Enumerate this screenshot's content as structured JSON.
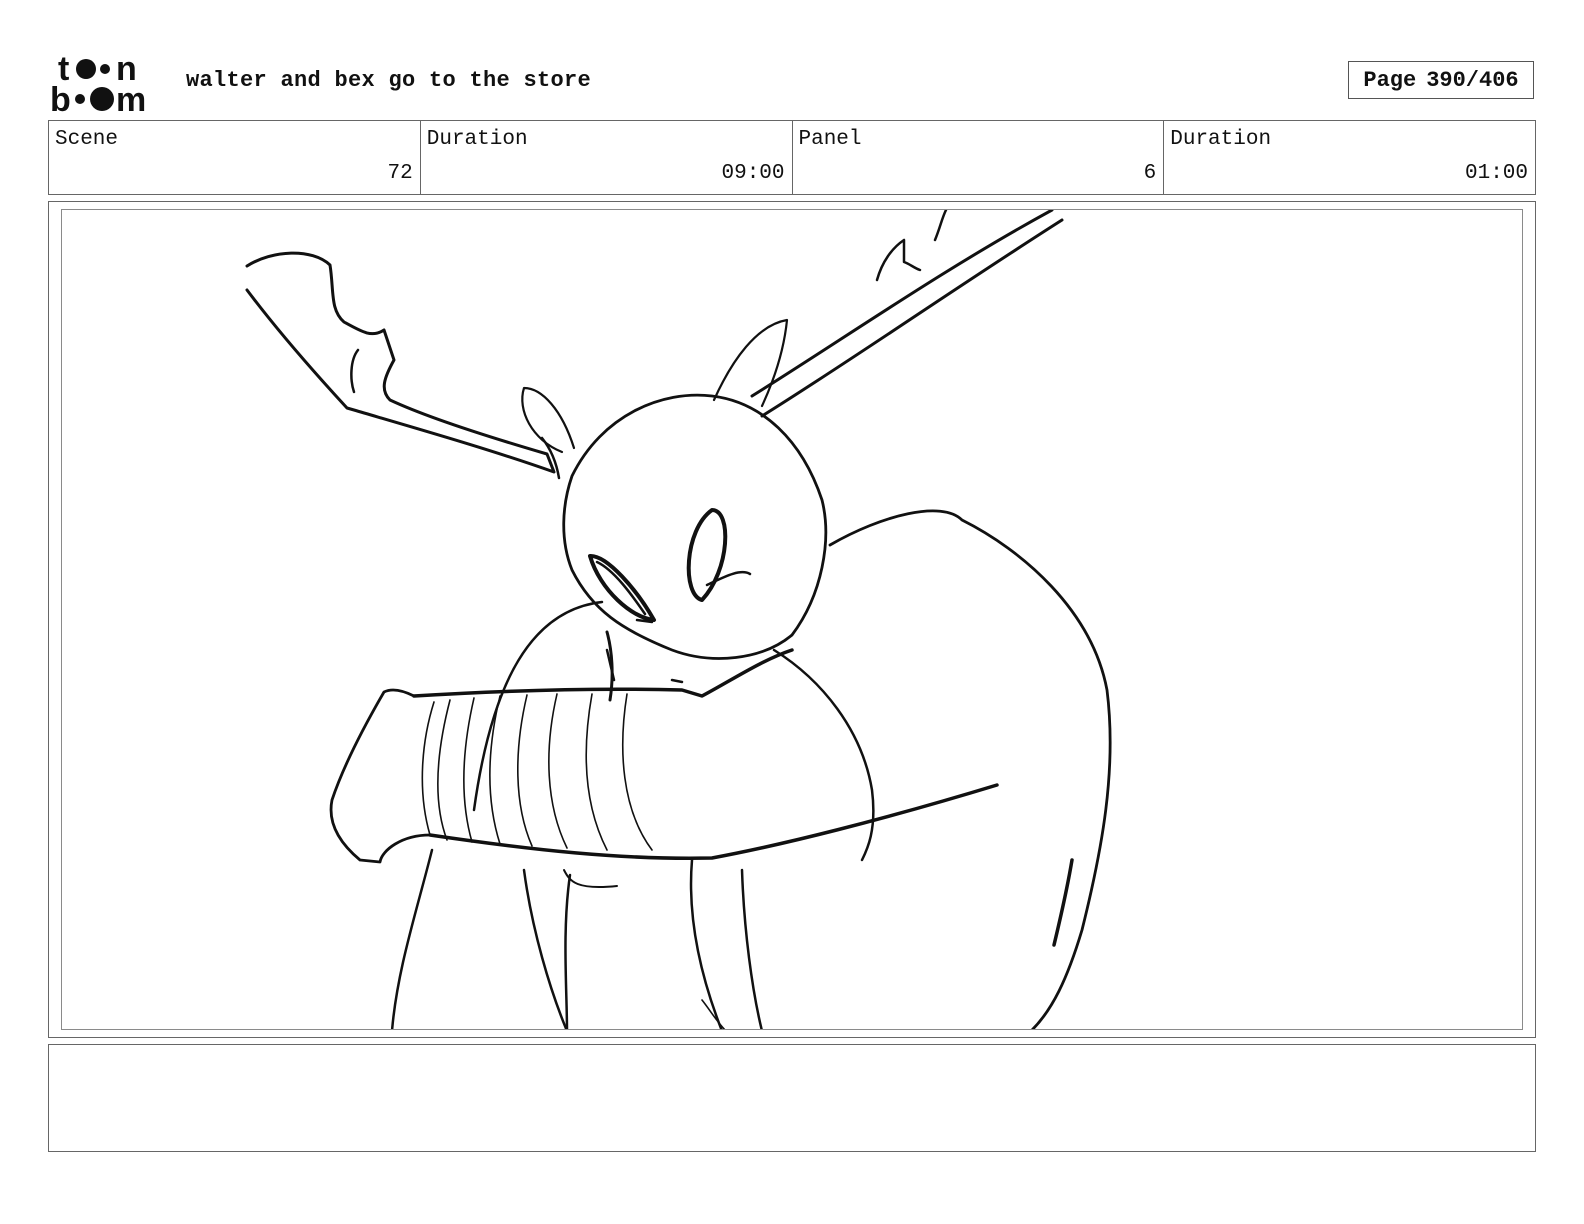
{
  "header": {
    "logo_text": "toon boom",
    "title": "walter and bex go to the store",
    "page_label": "Page",
    "page_value": "390/406"
  },
  "info": {
    "scene_label": "Scene",
    "scene_value": "72",
    "scene_duration_label": "Duration",
    "scene_duration_value": "09:00",
    "panel_label": "Panel",
    "panel_value": "6",
    "panel_duration_label": "Duration",
    "panel_duration_value": "01:00"
  },
  "notes": {
    "text": ""
  },
  "colors": {
    "ink": "#111111",
    "frame": "#666666"
  }
}
